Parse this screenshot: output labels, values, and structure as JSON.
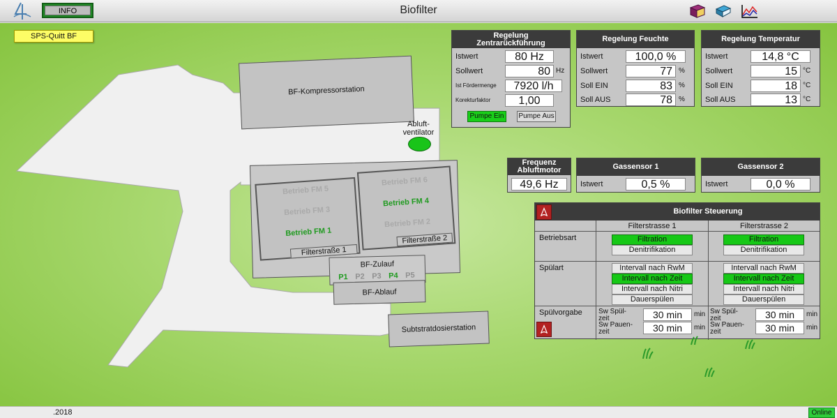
{
  "app": {
    "title": "Biofilter",
    "info_button": "INFO",
    "logo_icon": "logo-icon",
    "toolbar_icons": [
      "book-icon",
      "books-icon",
      "trend-chart-icon"
    ]
  },
  "sps_label": "SPS-Quitt BF",
  "site": {
    "kompressor": "BF-Kompressorstation",
    "abluft": "Abluft-\nventilator",
    "fm_left": [
      {
        "label": "Betrieb FM 5",
        "active": false
      },
      {
        "label": "Betrieb FM 3",
        "active": false
      },
      {
        "label": "Betrieb FM 1",
        "active": true
      }
    ],
    "fm_right": [
      {
        "label": "Betrieb FM 6",
        "active": false
      },
      {
        "label": "Betrieb FM 4",
        "active": true
      },
      {
        "label": "Betrieb FM 2",
        "active": false
      }
    ],
    "filterstrasse1": "Filterstraße 1",
    "filterstrasse2": "Filterstraße 2",
    "zulauf": "BF-Zulauf",
    "pumps": [
      {
        "label": "P1",
        "active": true
      },
      {
        "label": "P2",
        "active": false
      },
      {
        "label": "P3",
        "active": false
      },
      {
        "label": "P4",
        "active": true
      },
      {
        "label": "P5",
        "active": false
      }
    ],
    "ablauf": "BF-Ablauf",
    "substrat": "Subtstratdosierstation"
  },
  "rz": {
    "title": "Regelung\nZentrarückführung",
    "rows": [
      {
        "label": "Istwert",
        "value": "80 Hz",
        "unit": ""
      },
      {
        "label": "Sollwert",
        "value": "80",
        "unit": "Hz"
      },
      {
        "label": "Ist Fördermenge",
        "value": "7920 l/h",
        "unit": ""
      },
      {
        "label": "Korekturfaktor",
        "value": "1,00",
        "unit": ""
      }
    ],
    "btn_on": "Pumpe Ein",
    "btn_off": "Pumpe Aus"
  },
  "rf": {
    "title": "Regelung Feuchte",
    "rows": [
      {
        "label": "Istwert",
        "value": "100,0 %",
        "unit": ""
      },
      {
        "label": "Sollwert",
        "value": "77",
        "unit": "%"
      },
      {
        "label": "Soll EIN",
        "value": "83",
        "unit": "%"
      },
      {
        "label": "Soll AUS",
        "value": "78",
        "unit": "%"
      }
    ]
  },
  "rt": {
    "title": "Regelung Temperatur",
    "rows": [
      {
        "label": "Istwert",
        "value": "14,8 °C",
        "unit": ""
      },
      {
        "label": "Sollwert",
        "value": "15",
        "unit": "°C"
      },
      {
        "label": "Soll EIN",
        "value": "18",
        "unit": "°C"
      },
      {
        "label": "Soll AUS",
        "value": "13",
        "unit": "°C"
      }
    ]
  },
  "freq": {
    "title": "Frequenz\nAbluftmotor",
    "value": "49,6 Hz"
  },
  "gs1": {
    "title": "Gassensor 1",
    "label": "Istwert",
    "value": "0,5 %"
  },
  "gs2": {
    "title": "Gassensor 2",
    "label": "Istwert",
    "value": "0,0 %"
  },
  "steuerung": {
    "title": "Biofilter Steuerung",
    "pdf_icon": "pdf-icon",
    "col1": "Filterstrasse 1",
    "col2": "Filterstrasse 2",
    "betriebsart": {
      "label": "Betriebsart",
      "options": [
        "Filtration",
        "Denitrifikation"
      ],
      "selected1": 0,
      "selected2": 0
    },
    "spuelart": {
      "label": "Spülart",
      "options": [
        "Intervall nach RwM",
        "Intervall nach Zeit",
        "Intervall nach Nitri",
        "Dauerspülen"
      ],
      "selected1": 1,
      "selected2": 1
    },
    "spuelvorgabe": {
      "label": "Spülvorgabe",
      "spuel_label": "Sw Spül-\nzeit",
      "pause_label": "Sw Pauen-\nzeit",
      "fs1": {
        "spuel": "30 min",
        "pause": "30 min"
      },
      "fs2": {
        "spuel": "30 min",
        "pause": "30 min"
      },
      "unit": "min"
    }
  },
  "footer": {
    "date": ".2018",
    "status": "Online"
  },
  "colors": {
    "active": "#19cf19",
    "header": "#3b3b3b",
    "panel": "#c6c6c6",
    "grass": "#8fcb4a"
  }
}
